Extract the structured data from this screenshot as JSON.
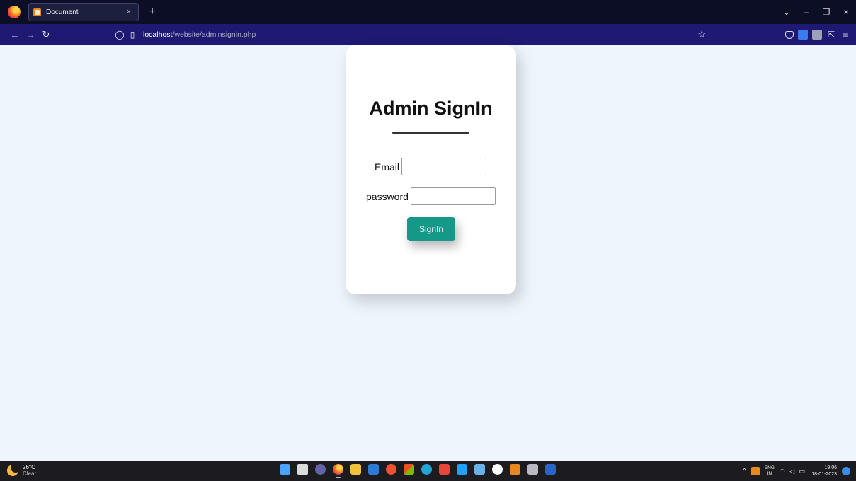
{
  "browser": {
    "tab_title": "Document",
    "tab_close": "×",
    "new_tab": "+",
    "url_host": "localhost",
    "url_path": "/website/adminsignin.php",
    "icons": [
      "firefox-icon",
      "back-icon",
      "forward-icon",
      "reload-icon",
      "shield-icon",
      "page-icon",
      "star-icon",
      "pocket-icon",
      "extension-icon",
      "reader-icon",
      "share-icon",
      "menu-icon"
    ],
    "window_controls": {
      "list": "⌄",
      "minimize": "–",
      "restore": "❐",
      "close": "×"
    }
  },
  "page": {
    "title": "Admin SignIn",
    "email_label": "Email",
    "email_value": "",
    "password_label": "password",
    "password_value": "",
    "submit_label": "SignIn",
    "accent_color": "#149887",
    "background_color": "#eef5fd"
  },
  "taskbar": {
    "weather_temp": "26°C",
    "weather_condition": "Clear",
    "language_line1": "ENG",
    "language_line2": "IN",
    "time": "19:06",
    "date": "18-01-2023",
    "apps": [
      "windows-start",
      "task-view",
      "teams",
      "firefox",
      "file-explorer",
      "notepad",
      "git",
      "app-store",
      "edge",
      "vlc",
      "vscode",
      "photos",
      "chrome",
      "xampp",
      "database",
      "word"
    ]
  }
}
